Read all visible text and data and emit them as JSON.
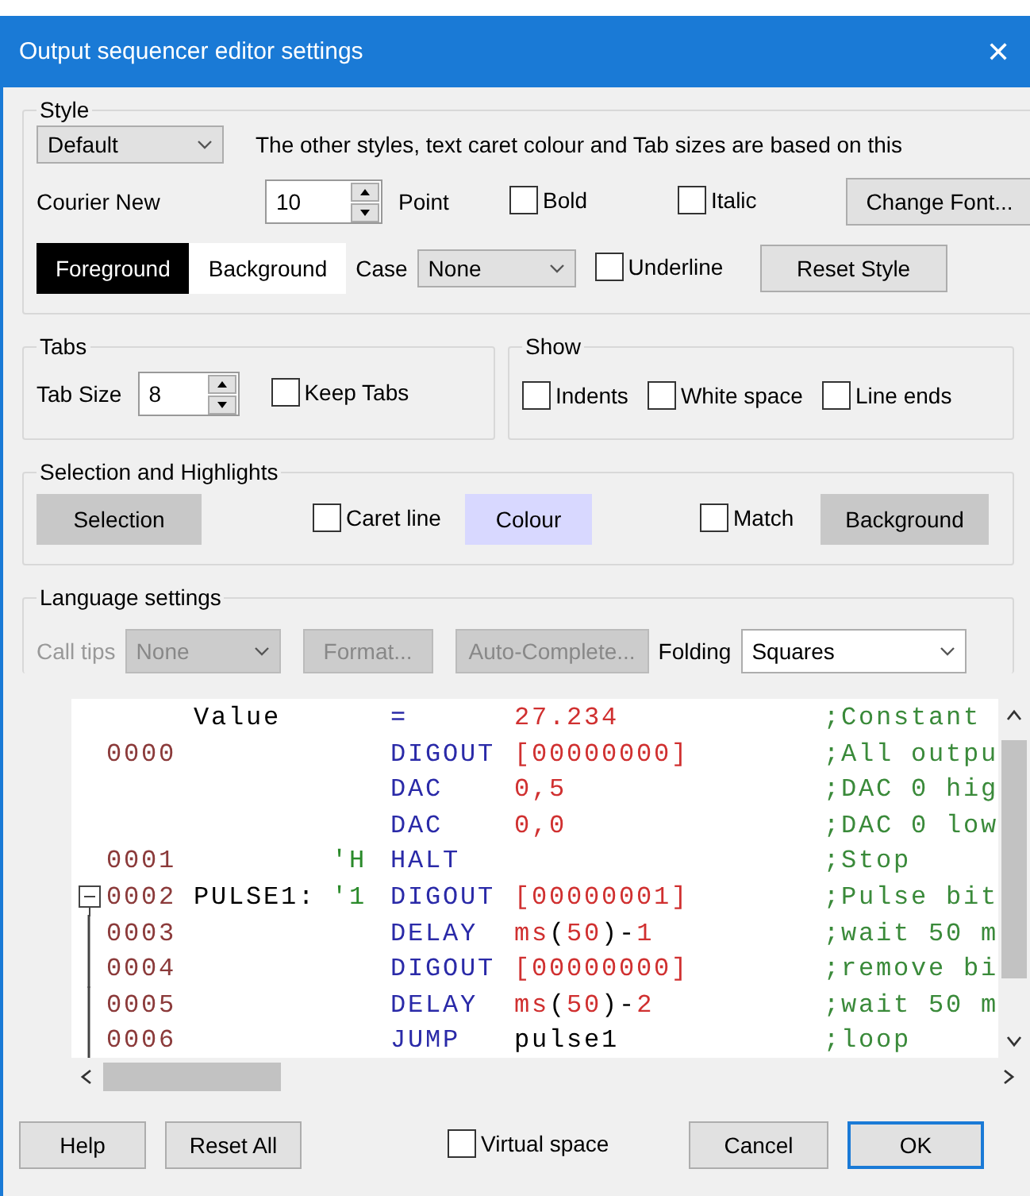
{
  "window": {
    "title": "Output sequencer editor settings",
    "close": "✕"
  },
  "style": {
    "legend": "Style",
    "style_select": "Default",
    "description": "The other styles, text caret colour and Tab sizes are based on this",
    "font_name": "Courier New",
    "size": "10",
    "size_label": "Point",
    "bold": {
      "label": "Bold",
      "checked": false
    },
    "italic": {
      "label": "Italic",
      "checked": false
    },
    "underline": {
      "label": "Underline",
      "checked": false
    },
    "change_font": "Change Font...",
    "foreground": "Foreground",
    "background": "Background",
    "case_label": "Case",
    "case_value": "None",
    "reset_style": "Reset Style"
  },
  "tabs": {
    "legend": "Tabs",
    "tab_size_label": "Tab Size",
    "tab_size": "8",
    "keep_tabs": {
      "label": "Keep Tabs",
      "checked": false
    }
  },
  "show": {
    "legend": "Show",
    "options": [
      {
        "label": "Indents",
        "checked": false
      },
      {
        "label": "White space",
        "checked": false
      },
      {
        "label": "Line ends",
        "checked": false
      }
    ]
  },
  "selection": {
    "legend": "Selection and Highlights",
    "selection_button": "Selection",
    "caret_line": {
      "label": "Caret line",
      "checked": false
    },
    "colour_button": "Colour",
    "match": {
      "label": "Match",
      "checked": false
    },
    "background_button": "Background"
  },
  "language": {
    "legend": "Language settings",
    "call_tips_label": "Call tips",
    "call_tips_value": "None",
    "format_button": "Format...",
    "autocomplete_button": "Auto-Complete...",
    "disabled": true,
    "folding_label": "Folding",
    "folding_value": "Squares"
  },
  "editor": {
    "rows": [
      {
        "line": "",
        "label": "Value",
        "marker": "",
        "keyword": "=",
        "args": [
          {
            "text": "27.234",
            "kind": "number"
          }
        ],
        "comment": ";Constant",
        "fold_start": false,
        "in_fold": false
      },
      {
        "line": "0000",
        "label": "",
        "marker": "",
        "keyword": "DIGOUT",
        "args": [
          {
            "text": "[00000000]",
            "kind": "number"
          }
        ],
        "comment": ";All outpu",
        "fold_start": false,
        "in_fold": false
      },
      {
        "line": "",
        "label": "",
        "marker": "",
        "keyword": "DAC",
        "args": [
          {
            "text": "0,5",
            "kind": "number"
          }
        ],
        "comment": ";DAC 0 hig",
        "fold_start": false,
        "in_fold": false
      },
      {
        "line": "",
        "label": "",
        "marker": "",
        "keyword": "DAC",
        "args": [
          {
            "text": "0,0",
            "kind": "number"
          }
        ],
        "comment": ";DAC 0 low",
        "fold_start": false,
        "in_fold": false
      },
      {
        "line": "0001",
        "label": "",
        "marker": "'H",
        "keyword": "HALT",
        "args": [],
        "comment": ";Stop",
        "fold_start": false,
        "in_fold": false
      },
      {
        "line": "0002",
        "label": "PULSE1:",
        "marker": "'1",
        "keyword": "DIGOUT",
        "args": [
          {
            "text": "[00000001]",
            "kind": "number"
          }
        ],
        "comment": ";Pulse bit",
        "fold_start": true,
        "in_fold": false
      },
      {
        "line": "0003",
        "label": "",
        "marker": "",
        "keyword": "DELAY",
        "args": [
          {
            "text": "ms",
            "kind": "number"
          },
          {
            "text": "(",
            "kind": "plain"
          },
          {
            "text": "50",
            "kind": "number"
          },
          {
            "text": ")-",
            "kind": "plain"
          },
          {
            "text": "1",
            "kind": "number"
          }
        ],
        "comment": ";wait 50 m",
        "fold_start": false,
        "in_fold": true
      },
      {
        "line": "0004",
        "label": "",
        "marker": "",
        "keyword": "DIGOUT",
        "args": [
          {
            "text": "[00000000]",
            "kind": "number"
          }
        ],
        "comment": ";remove bi",
        "fold_start": false,
        "in_fold": true
      },
      {
        "line": "0005",
        "label": "",
        "marker": "",
        "keyword": "DELAY",
        "args": [
          {
            "text": "ms",
            "kind": "number"
          },
          {
            "text": "(",
            "kind": "plain"
          },
          {
            "text": "50",
            "kind": "number"
          },
          {
            "text": ")-",
            "kind": "plain"
          },
          {
            "text": "2",
            "kind": "number"
          }
        ],
        "comment": ";wait 50 m",
        "fold_start": false,
        "in_fold": true
      },
      {
        "line": "0006",
        "label": "",
        "marker": "",
        "keyword": "JUMP",
        "args": [
          {
            "text": "pulse1",
            "kind": "plain"
          }
        ],
        "comment": ";loop",
        "fold_start": false,
        "in_fold": true
      }
    ]
  },
  "footer": {
    "help": "Help",
    "reset_all": "Reset All",
    "virtual_space": {
      "label": "Virtual space",
      "checked": false
    },
    "cancel": "Cancel",
    "ok": "OK"
  }
}
